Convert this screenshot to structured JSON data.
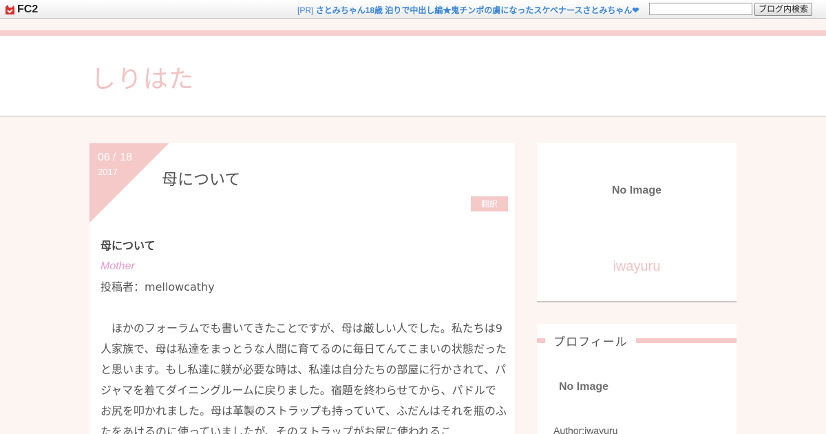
{
  "fc2bar": {
    "logo_text": "FC2",
    "pr_prefix": "[PR]",
    "pr_link": "さとみちゃん18歳 泊りで中出し編★鬼チンポの虜になったスケベナースさとみちゃん❤",
    "search_placeholder": "",
    "search_button": "ブログ内検索"
  },
  "header": {
    "site_title": "しりはた"
  },
  "article": {
    "date_month": "06",
    "date_sep": "/",
    "date_day": "18",
    "date_year": "2017",
    "title": "母について",
    "category": "翻訳",
    "heading": "母について",
    "english_title": "Mother",
    "author_line": "投稿者：mellowcathy",
    "paragraph": "　ほかのフォーラムでも書いてきたことですが、母は厳しい人でした。私たちは9人家族で、母は私達をまっとうな人間に育てるのに毎日てんてこまいの状態だったと思います。もし私達に躾が必要な時は、私達は自分たちの部屋に行かされて、パジャマを着てダイニングルームに戻りました。宿題を終わらせてから、パドルでお尻を叩かれました。母は革製のストラップも持っていて、ふだんはそれを瓶のふたをあけるのに使っていましたが、そのストラップがお尻に使われるこ"
  },
  "sidebar": {
    "top_card": {
      "no_image": "No Image",
      "author": "iwayuru"
    },
    "profile": {
      "heading": "プロフィール",
      "no_image": "No Image",
      "author": "Author:iwayuru"
    }
  },
  "colors": {
    "accent_pink": "#f6c9c9",
    "title_pink": "#f4c2c2",
    "background": "#fdf5f2",
    "link_blue": "#3a86d8"
  }
}
